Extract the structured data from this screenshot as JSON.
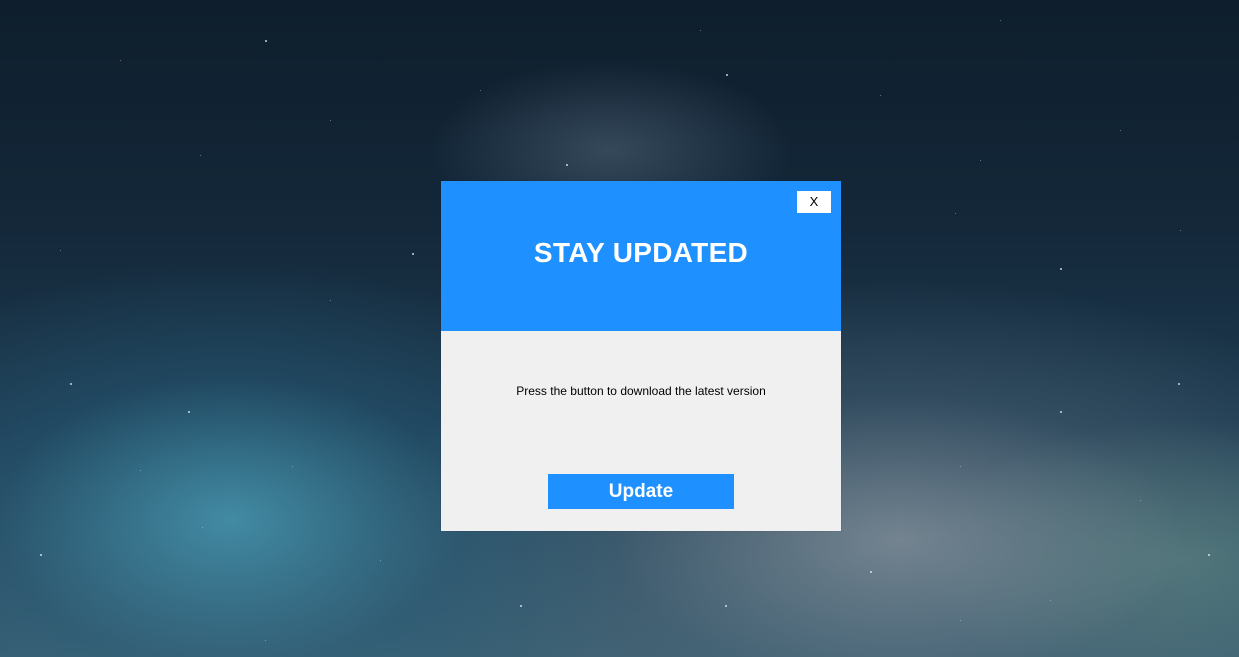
{
  "dialog": {
    "close_label": "X",
    "title": "STAY UPDATED",
    "message": "Press the button to download the latest version",
    "update_label": "Update"
  },
  "colors": {
    "accent": "#1e90ff",
    "dialog_body": "#f0f0f0",
    "close_button_bg": "#ffffff"
  }
}
